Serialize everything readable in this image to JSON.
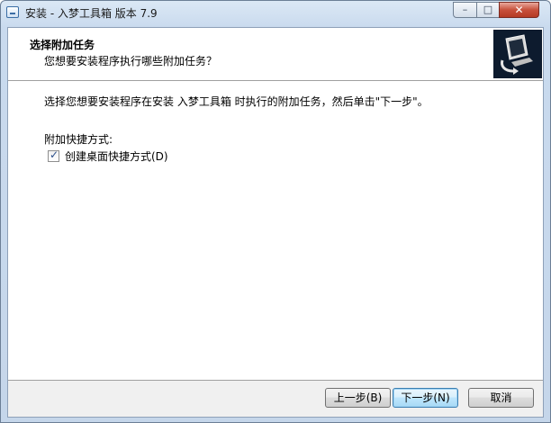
{
  "window": {
    "title": "安装 - 入梦工具箱 版本 7.9",
    "controls": {
      "minimize": "–",
      "maximize": "□",
      "close": "✕"
    }
  },
  "header": {
    "title": "选择附加任务",
    "subtitle": "您想要安装程序执行哪些附加任务？"
  },
  "body": {
    "instruction": "选择您想要安装程序在安装 入梦工具箱 时执行的附加任务，然后单击\"下一步\"。",
    "group_label": "附加快捷方式:",
    "options": [
      {
        "label": "创建桌面快捷方式(D)",
        "checked": true
      }
    ]
  },
  "buttons": {
    "back": "上一步(B)",
    "next": "下一步(N)",
    "cancel": "取消"
  },
  "icons": {
    "app": "installer-app-icon",
    "wizard": "computer-install-icon"
  }
}
